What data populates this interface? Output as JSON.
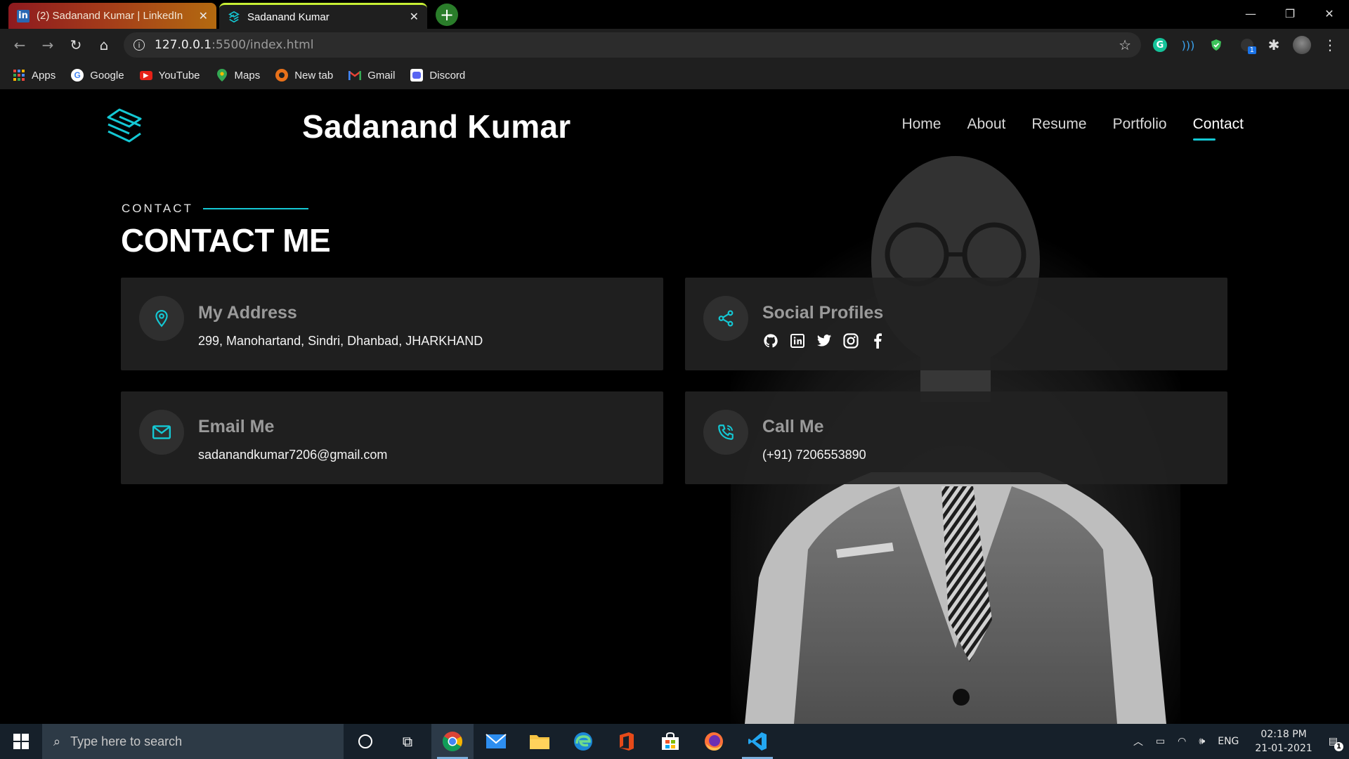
{
  "browser": {
    "tabs": [
      {
        "title": "(2) Sadanand Kumar | LinkedIn",
        "favicon": "linkedin-icon"
      },
      {
        "title": "Sadanand Kumar",
        "favicon": "site-logo-icon"
      }
    ],
    "address": {
      "host": "127.0.0.1",
      "path": ":5500/index.html"
    },
    "bookmarks": [
      {
        "label": "Apps",
        "icon": "apps-grid-icon"
      },
      {
        "label": "Google",
        "icon": "google-icon"
      },
      {
        "label": "YouTube",
        "icon": "youtube-icon"
      },
      {
        "label": "Maps",
        "icon": "maps-icon"
      },
      {
        "label": "New tab",
        "icon": "new-tab-icon"
      },
      {
        "label": "Gmail",
        "icon": "gmail-icon"
      },
      {
        "label": "Discord",
        "icon": "discord-icon"
      }
    ],
    "extension_badge": "1"
  },
  "site": {
    "brand": "Sadanand Kumar",
    "nav": [
      "Home",
      "About",
      "Resume",
      "Portfolio",
      "Contact"
    ],
    "active_nav": "Contact",
    "section_subtitle": "CONTACT",
    "section_title": "CONTACT ME",
    "cards": {
      "address": {
        "title": "My Address",
        "text": "299, Manohartand, Sindri, Dhanbad, JHARKHAND"
      },
      "social": {
        "title": "Social Profiles",
        "icons": [
          "github-icon",
          "linkedin-icon",
          "twitter-icon",
          "instagram-icon",
          "facebook-icon"
        ]
      },
      "email": {
        "title": "Email Me",
        "text": "sadanandkumar7206@gmail.com"
      },
      "phone": {
        "title": "Call Me",
        "text": "(+91) 7206553890"
      }
    },
    "accent": "#14c8d4"
  },
  "taskbar": {
    "search_placeholder": "Type here to search",
    "language": "ENG",
    "time": "02:18 PM",
    "date": "21-01-2021",
    "notification_count": "1"
  }
}
